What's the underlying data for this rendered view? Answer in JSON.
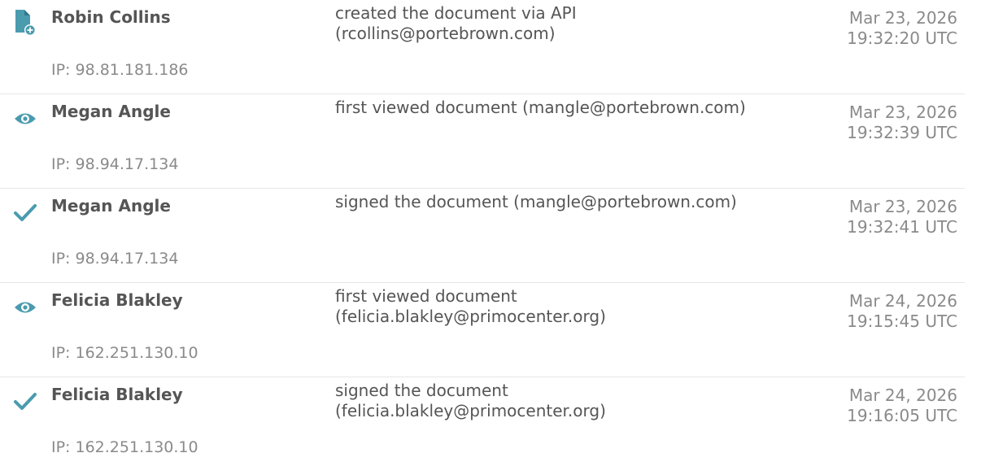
{
  "colors": {
    "accent": "#4a9bae",
    "name_text": "#555555",
    "muted_text": "#8a8a8a",
    "separator": "#e6e6e6"
  },
  "entries": [
    {
      "icon": "document-add-icon",
      "name": "Robin Collins",
      "action_line1": "created the document via API",
      "action_line2": "(rcollins@portebrown.com)",
      "date": "Mar 23, 2026",
      "time": "19:32:20 UTC",
      "ip": "IP: 98.81.181.186"
    },
    {
      "icon": "eye-icon",
      "name": "Megan Angle",
      "action_line1": "first viewed document (mangle@portebrown.com)",
      "action_line2": "",
      "date": "Mar 23, 2026",
      "time": "19:32:39 UTC",
      "ip": "IP: 98.94.17.134"
    },
    {
      "icon": "checkmark-icon",
      "name": "Megan Angle",
      "action_line1": "signed the document (mangle@portebrown.com)",
      "action_line2": "",
      "date": "Mar 23, 2026",
      "time": "19:32:41 UTC",
      "ip": "IP: 98.94.17.134"
    },
    {
      "icon": "eye-icon",
      "name": "Felicia Blakley",
      "action_line1": "first viewed document",
      "action_line2": "(felicia.blakley@primocenter.org)",
      "date": "Mar 24, 2026",
      "time": "19:15:45 UTC",
      "ip": "IP: 162.251.130.10"
    },
    {
      "icon": "checkmark-icon",
      "name": "Felicia Blakley",
      "action_line1": "signed the document",
      "action_line2": "(felicia.blakley@primocenter.org)",
      "date": "Mar 24, 2026",
      "time": "19:16:05 UTC",
      "ip": "IP: 162.251.130.10"
    }
  ]
}
